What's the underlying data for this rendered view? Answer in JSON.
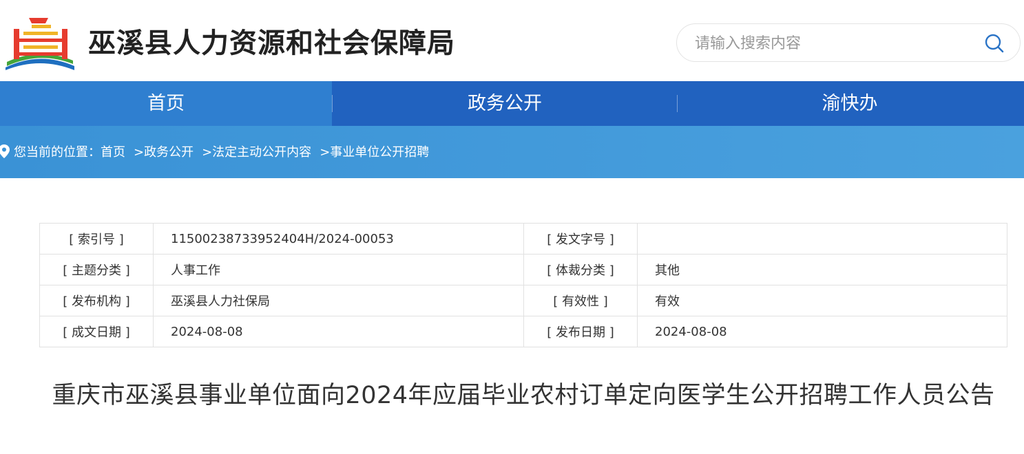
{
  "header": {
    "site_title": "巫溪县人力资源和社会保障局",
    "search_placeholder": "请输入搜索内容"
  },
  "nav": {
    "items": [
      {
        "label": "首页",
        "active": true
      },
      {
        "label": "政务公开",
        "active": false
      },
      {
        "label": "渝快办",
        "active": false
      }
    ]
  },
  "breadcrumb": {
    "prefix": "您当前的位置：",
    "items": [
      "首页",
      ">政务公开",
      ">法定主动公开内容",
      ">事业单位公开招聘"
    ]
  },
  "meta": {
    "rows": [
      {
        "k1": "[ 索引号 ]",
        "v1": "11500238733952404H/2024-00053",
        "k2": "[ 发文字号 ]",
        "v2": ""
      },
      {
        "k1": "[ 主题分类 ]",
        "v1": "人事工作",
        "k2": "[ 体裁分类 ]",
        "v2": "其他"
      },
      {
        "k1": "[ 发布机构 ]",
        "v1": "巫溪县人力社保局",
        "k2": "[ 有效性 ]",
        "v2": "有效"
      },
      {
        "k1": "[ 成文日期 ]",
        "v1": "2024-08-08",
        "k2": "[ 发布日期 ]",
        "v2": "2024-08-08"
      }
    ]
  },
  "article": {
    "title": "重庆市巫溪县事业单位面向2024年应届毕业农村订单定向医学生公开招聘工作人员公告"
  },
  "colors": {
    "nav_bg": "#2162bf",
    "nav_active": "#2f7fd0",
    "crumb_bg": "#3a92d6",
    "search_icon": "#2a73c6"
  }
}
